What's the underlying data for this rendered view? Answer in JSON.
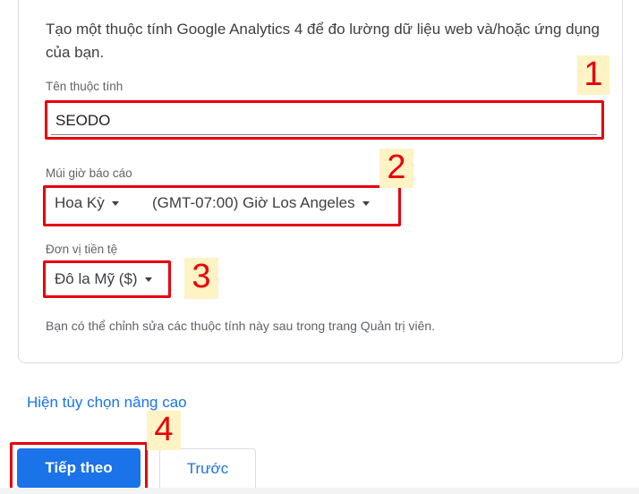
{
  "form": {
    "description": "Tạo một thuộc tính Google Analytics 4 để đo lường dữ liệu web và/hoặc ứng dụng của bạn.",
    "property_name": {
      "label": "Tên thuộc tính",
      "value": "SEODO"
    },
    "timezone": {
      "label": "Múi giờ báo cáo",
      "country": "Hoa Kỳ",
      "zone": "(GMT-07:00) Giờ Los Angeles"
    },
    "currency": {
      "label": "Đơn vị tiền tệ",
      "value": "Đô la Mỹ ($)"
    },
    "note": "Bạn có thể chỉnh sửa các thuộc tính này sau trong trang Quản trị viên."
  },
  "advanced_link": "Hiện tùy chọn nâng cao",
  "buttons": {
    "next": "Tiếp theo",
    "previous": "Trước"
  },
  "annotations": [
    "1",
    "2",
    "3",
    "4"
  ],
  "colors": {
    "accent": "#1a73e8",
    "annotation": "#e8000b",
    "annotation_bg": "#fdf3c4"
  }
}
